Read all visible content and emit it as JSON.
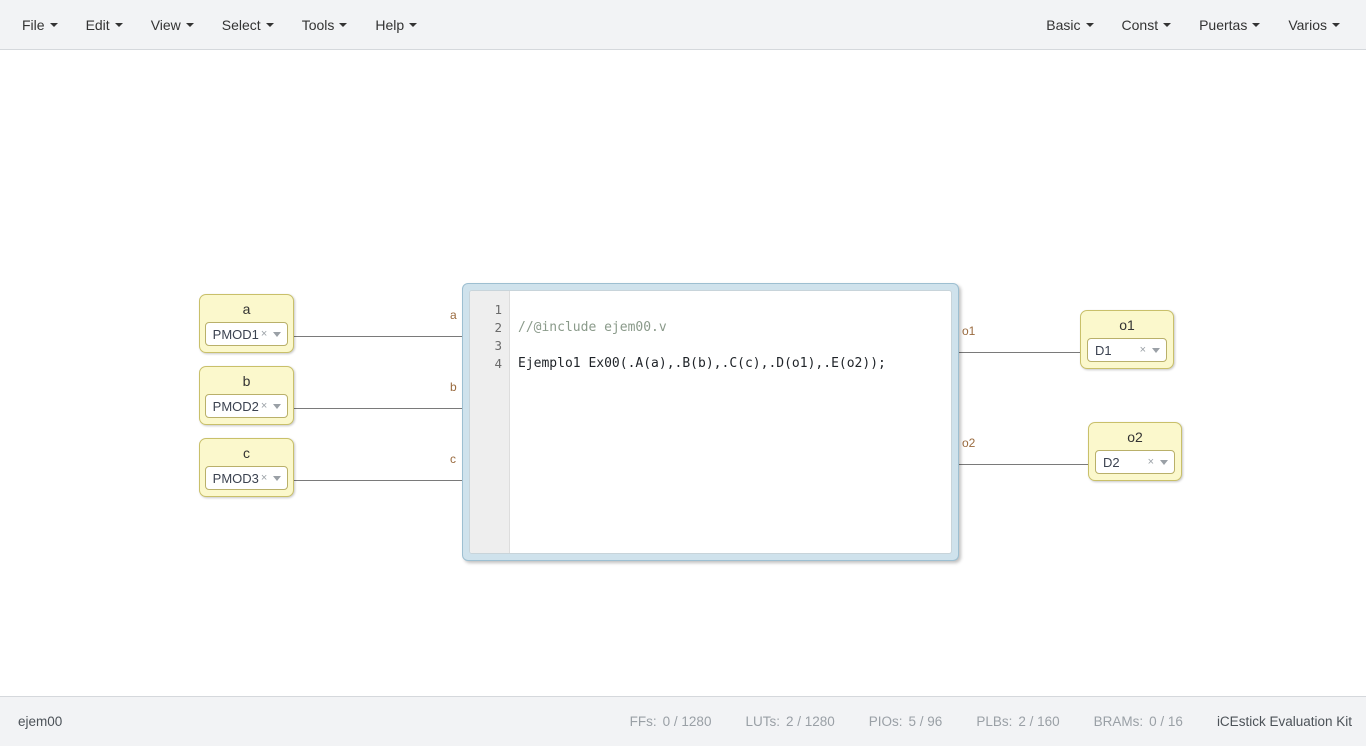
{
  "menubar": {
    "left_items": [
      {
        "label": "File",
        "name": "menu-file",
        "caret": true
      },
      {
        "label": "Edit",
        "name": "menu-edit",
        "caret": true
      },
      {
        "label": "View",
        "name": "menu-view",
        "caret": true
      },
      {
        "label": "Select",
        "name": "menu-select",
        "caret": true
      },
      {
        "label": "Tools",
        "name": "menu-tools",
        "caret": true
      },
      {
        "label": "Help",
        "name": "menu-help",
        "caret": true
      }
    ],
    "right_items": [
      {
        "label": "Basic",
        "name": "menu-basic",
        "caret": true
      },
      {
        "label": "Const",
        "name": "menu-const",
        "caret": true
      },
      {
        "label": "Puertas",
        "name": "menu-puertas",
        "caret": true
      },
      {
        "label": "Varios",
        "name": "menu-varios",
        "caret": true
      }
    ]
  },
  "canvas": {
    "input_blocks": [
      {
        "title": "a",
        "pin": "PMOD1",
        "clear": "×"
      },
      {
        "title": "b",
        "pin": "PMOD2",
        "clear": "×"
      },
      {
        "title": "c",
        "pin": "PMOD3",
        "clear": "×"
      }
    ],
    "output_blocks": [
      {
        "title": "o1",
        "pin": "D1",
        "clear": "×"
      },
      {
        "title": "o2",
        "pin": "D2",
        "clear": "×"
      }
    ],
    "wire_labels": {
      "in": [
        "a",
        "b",
        "c"
      ],
      "out": [
        "o1",
        "o2"
      ]
    },
    "code_block": {
      "line_numbers": [
        "1",
        "2",
        "3",
        "4"
      ],
      "lines": [
        {
          "text": "",
          "kind": "code"
        },
        {
          "text": "//@include ejem00.v",
          "kind": "comment"
        },
        {
          "text": "",
          "kind": "code"
        },
        {
          "text": "Ejemplo1 Ex00(.A(a),.B(b),.C(c),.D(o1),.E(o2));",
          "kind": "code"
        }
      ]
    }
  },
  "statusbar": {
    "project_name": "ejem00",
    "stats": [
      {
        "label": "FFs:",
        "value": "0 / 1280"
      },
      {
        "label": "LUTs:",
        "value": "2 / 1280"
      },
      {
        "label": "PIOs:",
        "value": "5 / 96"
      },
      {
        "label": "PLBs:",
        "value": "2 / 160"
      },
      {
        "label": "BRAMs:",
        "value": "0 / 16"
      }
    ],
    "board": "iCEstick Evaluation Kit"
  },
  "colors": {
    "chrome_bg": "#f2f3f5",
    "block_yellow": "#fbf8cc",
    "block_border": "#c9c06a",
    "code_border": "#cfe2ec",
    "wire": "#7a7a7a",
    "wire_label": "#9a6b3f",
    "muted_text": "#9aa0a6"
  }
}
